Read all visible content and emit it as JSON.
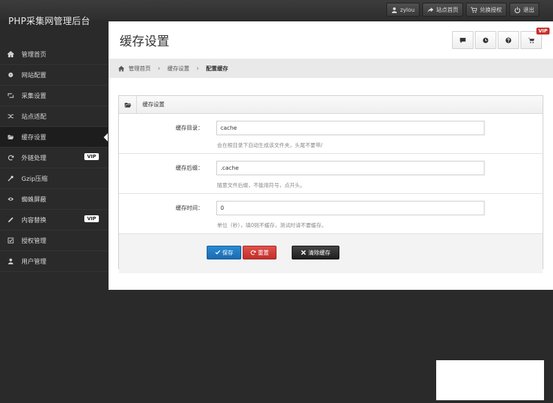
{
  "brand": {
    "title": "PHP采集网管理后台"
  },
  "topnav": [
    {
      "icon": "user-icon",
      "label": "zylou"
    },
    {
      "icon": "share-icon",
      "label": "站点首页"
    },
    {
      "icon": "cart-icon",
      "label": "兑换授权"
    },
    {
      "icon": "power-icon",
      "label": "退出"
    }
  ],
  "sidebar": {
    "items": [
      {
        "icon": "home-icon",
        "label": "管理首页"
      },
      {
        "icon": "gear-icon",
        "label": "网站配置"
      },
      {
        "icon": "retweet-icon",
        "label": "采集设置"
      },
      {
        "icon": "random-icon",
        "label": "站点适配"
      },
      {
        "icon": "folder-open-icon",
        "label": "缓存设置"
      },
      {
        "icon": "refresh-icon",
        "label": "外链处理",
        "badge": "VIP"
      },
      {
        "icon": "wrench-icon",
        "label": "Gzip压缩"
      },
      {
        "icon": "eye-icon",
        "label": "蜘蛛屏蔽"
      },
      {
        "icon": "pencil-icon",
        "label": "内容替换",
        "badge": "VIP"
      },
      {
        "icon": "check-icon",
        "label": "授权管理"
      },
      {
        "icon": "user-icon",
        "label": "用户管理"
      }
    ],
    "active_index": 4
  },
  "page": {
    "title": "缓存设置",
    "vip_badge": "VIP"
  },
  "breadcrumb": {
    "items": [
      "管理首页",
      "缓存设置"
    ],
    "current": "配置缓存"
  },
  "form": {
    "box_title": "缓存设置",
    "fields": [
      {
        "label": "缓存目录：",
        "value": "cache",
        "help": "会在根目录下自动生成该文件夹，头尾不要带/"
      },
      {
        "label": "缓存后缀：",
        "value": ".cache",
        "help": "随意文件后缀，不能用符号，点开头。"
      },
      {
        "label": "缓存时间：",
        "value": "0",
        "help": "单位（秒），填0则不缓存，测试时请不要缓存。"
      }
    ],
    "buttons": {
      "save": "保存",
      "reset": "重置",
      "clear": "清除缓存"
    }
  }
}
